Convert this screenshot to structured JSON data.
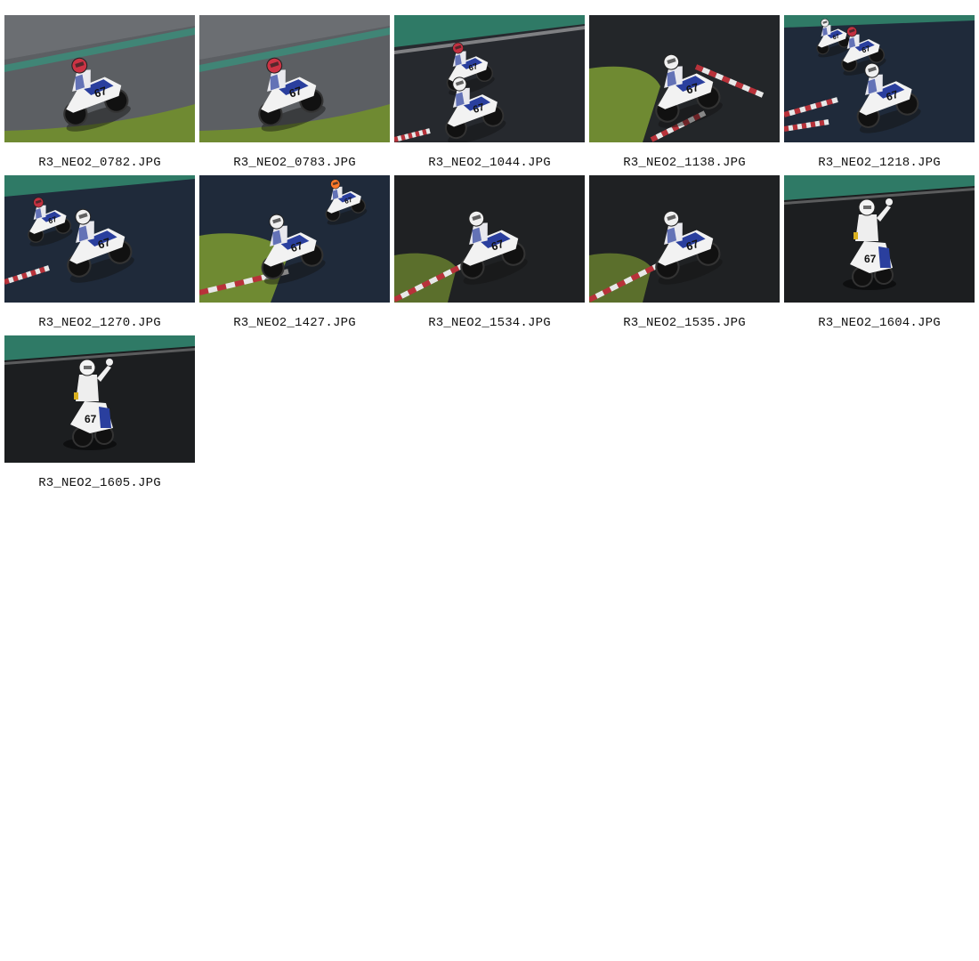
{
  "gallery": {
    "items": [
      {
        "filename": "R3_NEO2_0782.JPG",
        "scene": "gray-track-lean"
      },
      {
        "filename": "R3_NEO2_0783.JPG",
        "scene": "gray-track-lean"
      },
      {
        "filename": "R3_NEO2_1044.JPG",
        "scene": "two-riders-dark"
      },
      {
        "filename": "R3_NEO2_1138.JPG",
        "scene": "grass-curb-lean"
      },
      {
        "filename": "R3_NEO2_1218.JPG",
        "scene": "group-riders-dark"
      },
      {
        "filename": "R3_NEO2_1270.JPG",
        "scene": "two-riders-lean"
      },
      {
        "filename": "R3_NEO2_1427.JPG",
        "scene": "grass-curb-two"
      },
      {
        "filename": "R3_NEO2_1534.JPG",
        "scene": "dark-curb-lean"
      },
      {
        "filename": "R3_NEO2_1535.JPG",
        "scene": "dark-curb-lean"
      },
      {
        "filename": "R3_NEO2_1604.JPG",
        "scene": "wave-rider"
      },
      {
        "filename": "R3_NEO2_1605.JPG",
        "scene": "wave-rider"
      }
    ]
  },
  "colors": {
    "caption_text": "#111111",
    "page_background": "#ffffff",
    "track_gray": "#5c5f63",
    "track_dark": "#26292e",
    "track_blue_dark": "#1f2a3a",
    "grass": "#6f8a32",
    "green_band": "#2f7a66",
    "curb_red": "#b8323a",
    "bike_white": "#f2f2f2",
    "bike_blue": "#2a3f9e"
  }
}
